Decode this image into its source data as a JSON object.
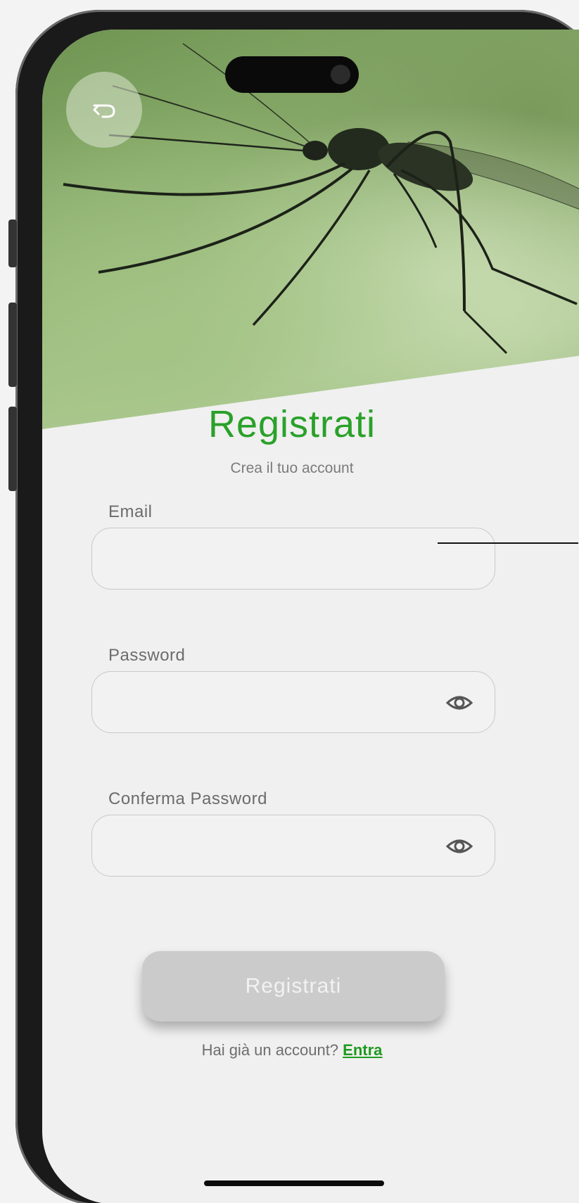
{
  "header": {
    "back_icon": "undo-arrow-icon"
  },
  "form": {
    "title": "Registrati",
    "subtitle": "Crea il tuo account",
    "fields": [
      {
        "label": "Email",
        "value": "",
        "type": "email"
      },
      {
        "label": "Password",
        "value": "",
        "type": "password",
        "icon": "eye-icon"
      },
      {
        "label": "Conferma Password",
        "value": "",
        "type": "password",
        "icon": "eye-icon"
      }
    ],
    "submit_label": "Registrati"
  },
  "footer": {
    "prompt": "Hai già un account?",
    "link_label": "Entra"
  },
  "colors": {
    "accent": "#2aa12a",
    "button_disabled": "#cbcbcb",
    "background": "#f0f0f0"
  }
}
